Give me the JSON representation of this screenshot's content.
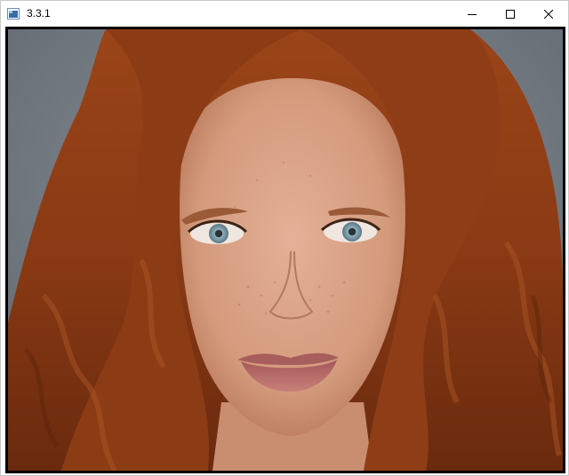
{
  "window": {
    "title": "3.3.1",
    "app_icon": "opencv-window-icon",
    "controls": {
      "minimize_icon": "minimize-icon",
      "maximize_icon": "maximize-icon",
      "close_icon": "close-icon"
    }
  },
  "image": {
    "content": "photo",
    "colors": {
      "background": "#6e747c",
      "hair": "#8a3b14",
      "skin": "#d9a184",
      "eyes": "#7e9aa8",
      "lips": "#b76c66"
    }
  }
}
